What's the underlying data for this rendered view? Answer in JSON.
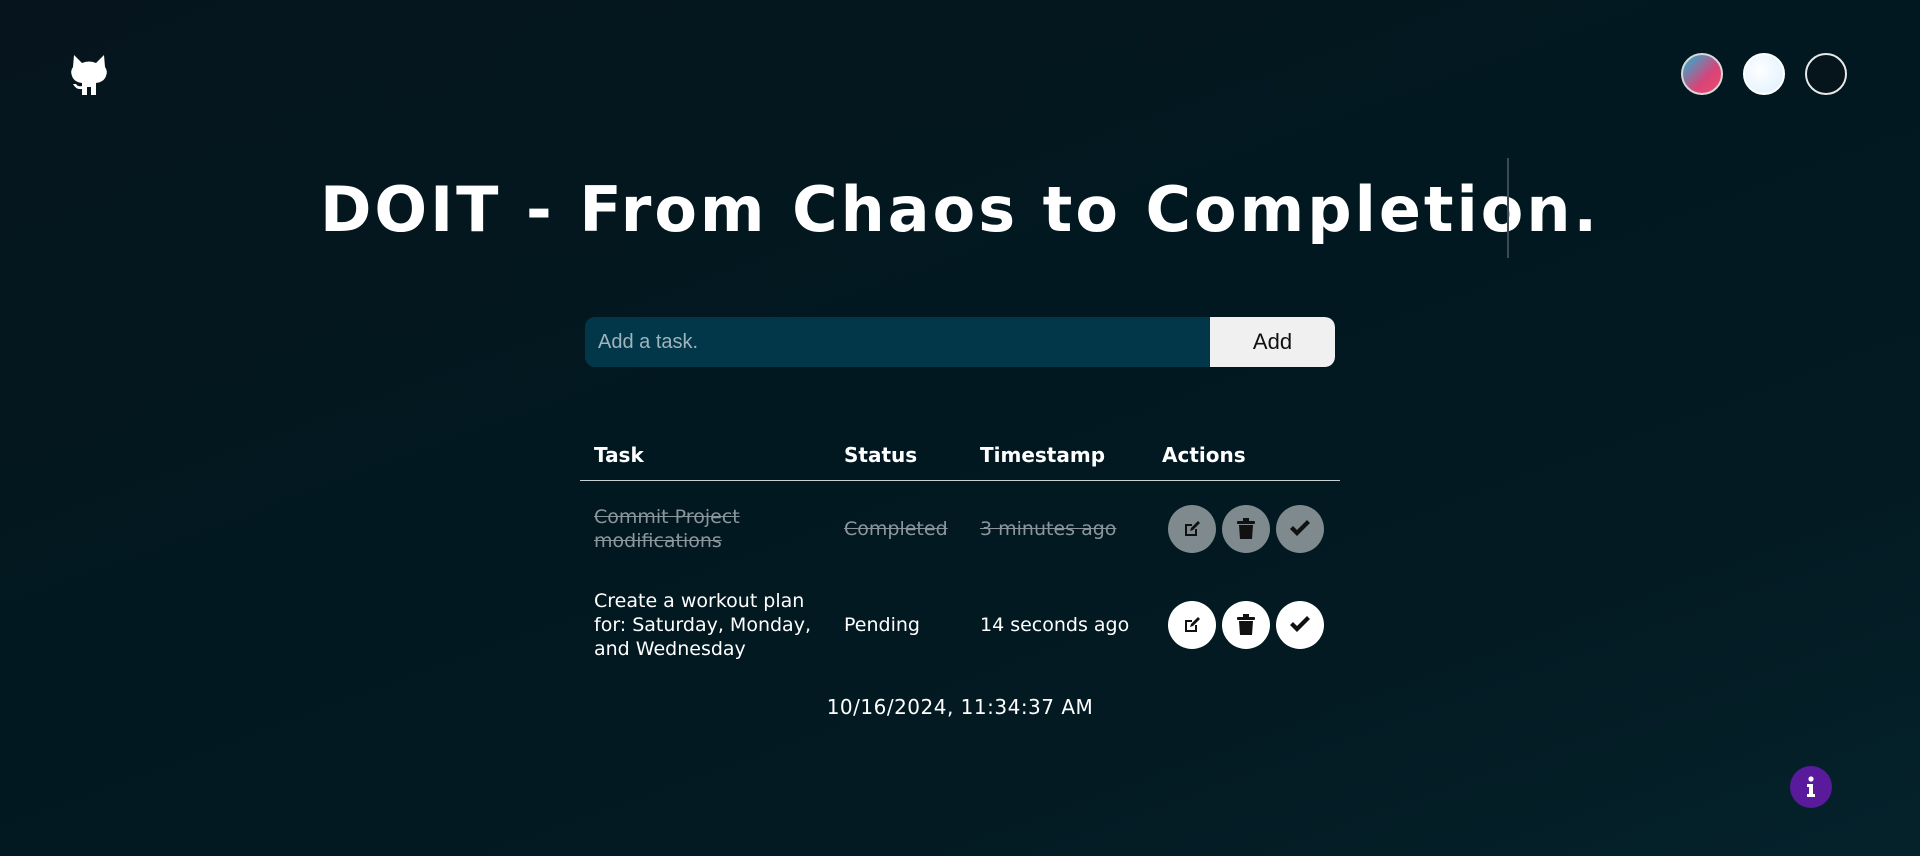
{
  "header": {
    "github_icon": "github-icon",
    "title": "DOIT - From Chaos to Completion.",
    "themes": [
      "gradient-theme",
      "light-theme",
      "dark-theme"
    ]
  },
  "form": {
    "placeholder": "Add a task.",
    "value": "",
    "add_label": "Add"
  },
  "table": {
    "headers": {
      "task": "Task",
      "status": "Status",
      "timestamp": "Timestamp",
      "actions": "Actions"
    },
    "rows": [
      {
        "task": "Commit Project modifications",
        "status": "Completed",
        "timestamp": "3 minutes ago",
        "completed": true
      },
      {
        "task": "Create a workout plan for: Saturday, Monday, and Wednesday",
        "status": "Pending",
        "timestamp": "14 seconds ago",
        "completed": false
      }
    ],
    "action_icons": [
      "edit-icon",
      "trash-icon",
      "check-icon"
    ]
  },
  "footer": {
    "datetime": "10/16/2024, 11:34:37 AM",
    "info_icon": "info-icon"
  },
  "colors": {
    "background": "#021820",
    "input_bg": "#023749",
    "info_button": "#5a1a9c",
    "completed_text": "#8a969b"
  }
}
